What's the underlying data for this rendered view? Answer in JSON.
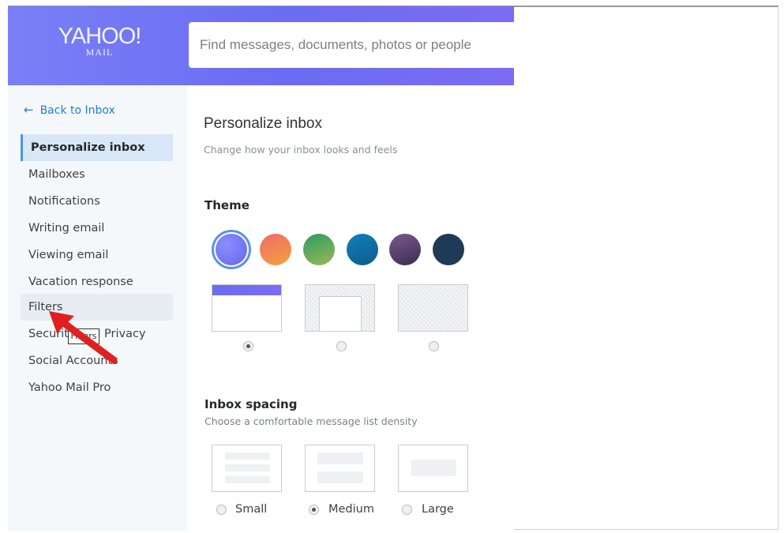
{
  "logo": {
    "main": "YAHOO!",
    "sub": "MAIL"
  },
  "search": {
    "placeholder": "Find messages, documents, photos or people"
  },
  "sidebar": {
    "back": "Back to Inbox",
    "items": [
      {
        "label": "Personalize inbox",
        "state": "active"
      },
      {
        "label": "Mailboxes"
      },
      {
        "label": "Notifications"
      },
      {
        "label": "Writing email"
      },
      {
        "label": "Viewing email"
      },
      {
        "label": "Vacation response"
      },
      {
        "label": "Filters",
        "state": "hover"
      },
      {
        "label": "Security and Privacy"
      },
      {
        "label": "Social Accounts"
      },
      {
        "label": "Yahoo Mail Pro"
      }
    ],
    "tooltip": "Filters"
  },
  "main": {
    "title": "Personalize inbox",
    "subtitle": "Change how your inbox looks and feels",
    "theme": {
      "heading": "Theme",
      "colors": [
        "#6f73f6",
        "#f07a4e",
        "#3aa56a",
        "#1a7fb6",
        "#5a4476",
        "#1f3a57"
      ],
      "selected_color": 0,
      "selected_layout": 0
    },
    "spacing": {
      "heading": "Inbox spacing",
      "subtitle": "Choose a comfortable message list density",
      "options": [
        "Small",
        "Medium",
        "Large"
      ],
      "selected": "Medium"
    }
  },
  "colors": {
    "accent": "#4e94e5",
    "link": "#1e7fd8",
    "header": "#6a6cf2",
    "pointer_arrow": "#e02020"
  }
}
